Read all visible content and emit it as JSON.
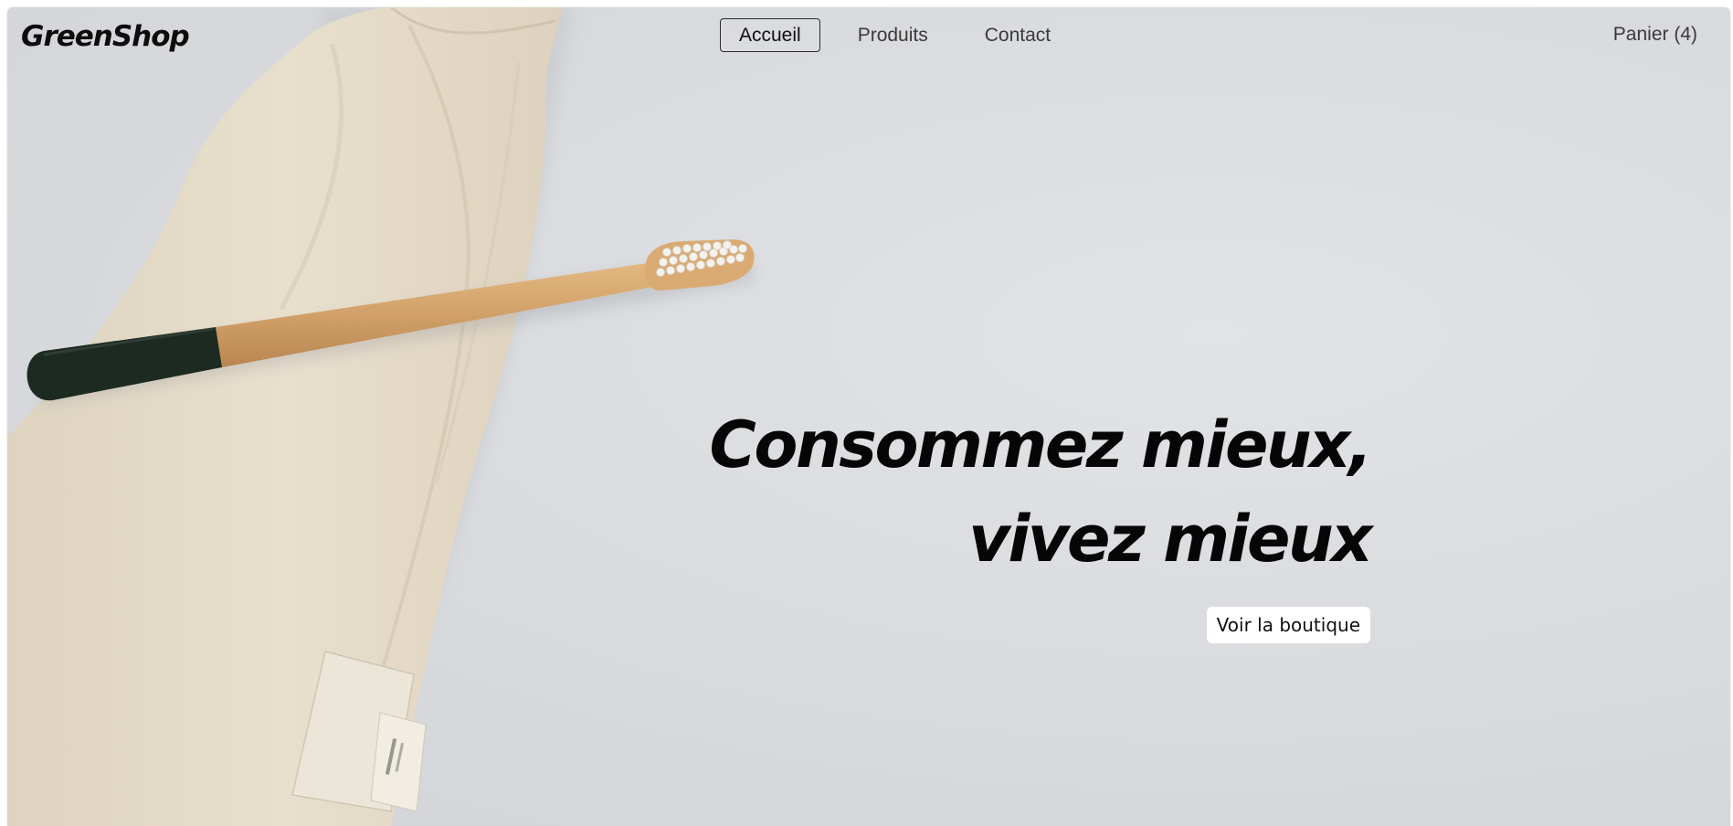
{
  "brand": {
    "logo_text": "GreenShop"
  },
  "nav": {
    "items": [
      {
        "label": "Accueil",
        "active": true
      },
      {
        "label": "Produits",
        "active": false
      },
      {
        "label": "Contact",
        "active": false
      }
    ]
  },
  "cart": {
    "label": "Panier (4)"
  },
  "hero": {
    "headline_line1": "Consommez mieux,",
    "headline_line2": "vivez mieux",
    "cta_label": "Voir la boutique"
  },
  "colors": {
    "background": "#d8dadd",
    "text": "#060606",
    "cta_background": "#ffffff",
    "bag": "#e6ddcc",
    "brush_handle": "#d6a86e",
    "brush_end": "#1d2a22"
  }
}
